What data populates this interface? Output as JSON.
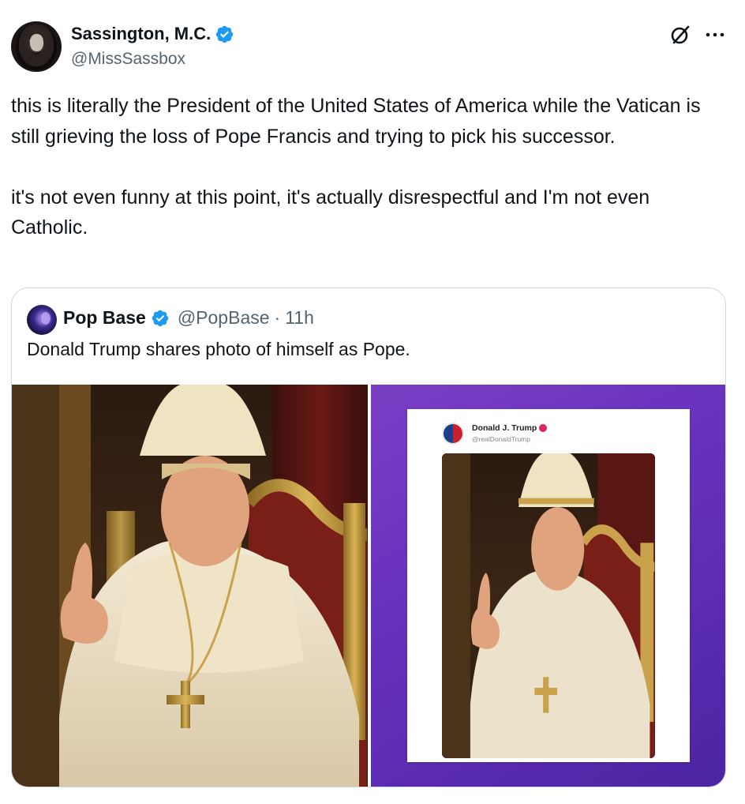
{
  "author": {
    "display_name": "Sassington, M.C.",
    "handle": "@MissSassbox",
    "verified_color": "#1d9bf0"
  },
  "tweet": {
    "text": "this is literally the President of the United States of America while the Vatican is still grieving the loss of Pope Francis and trying to pick his successor.\n\nit's not even funny at this point, it's actually disrespectful and I'm not even Catholic."
  },
  "icons": {
    "grok": "grok-icon",
    "more": "more-options-icon"
  },
  "quote": {
    "display_name": "Pop Base",
    "handle": "@PopBase",
    "separator": "·",
    "time": "11h",
    "text": "Donald Trump shares photo of himself as Pope.",
    "media": [
      {
        "description_icon": "image-trump-as-pope"
      },
      {
        "description_icon": "image-screenshot-of-truth-post",
        "embedded_post": {
          "name": "Donald J. Trump",
          "handle": "@realDonaldTrump",
          "badge_color": "#e0245e"
        }
      }
    ]
  },
  "colors": {
    "text_primary": "#0f1419",
    "text_secondary": "#536471",
    "border": "#cfd9de",
    "right_image_bg": "#6a33bd"
  }
}
